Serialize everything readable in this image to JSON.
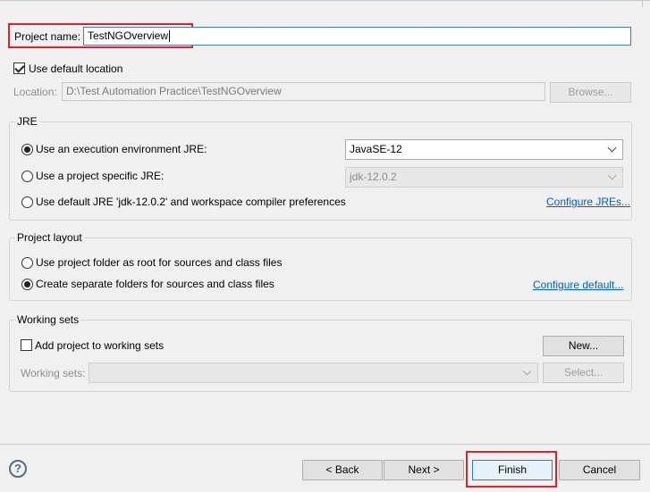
{
  "project": {
    "name_label": "Project name:",
    "name_value": "TestNGOverview"
  },
  "location": {
    "use_default_label": "Use default location",
    "use_default_checked": true,
    "label": "Location:",
    "value": "D:\\Test Automation Practice\\TestNGOverview",
    "browse_label": "Browse..."
  },
  "jre": {
    "group_title": "JRE",
    "options": [
      {
        "label": "Use an execution environment JRE:",
        "checked": true
      },
      {
        "label": "Use a project specific JRE:",
        "checked": false
      },
      {
        "label": "Use default JRE 'jdk-12.0.2' and workspace compiler preferences",
        "checked": false
      }
    ],
    "execution_env_value": "JavaSE-12",
    "project_jre_value": "jdk-12.0.2",
    "configure_link": "Configure JREs..."
  },
  "layout": {
    "group_title": "Project layout",
    "options": [
      {
        "label": "Use project folder as root for sources and class files",
        "checked": false
      },
      {
        "label": "Create separate folders for sources and class files",
        "checked": true
      }
    ],
    "configure_link": "Configure default..."
  },
  "working_sets": {
    "group_title": "Working sets",
    "add_label": "Add project to working sets",
    "add_checked": false,
    "new_button": "New...",
    "sets_label": "Working sets:",
    "sets_value": "",
    "select_button": "Select..."
  },
  "footer": {
    "help_glyph": "?",
    "back_button": "< Back",
    "next_button": "Next >",
    "finish_button": "Finish",
    "cancel_button": "Cancel"
  },
  "colors": {
    "highlight_box": "#e0202c",
    "link": "#0060c0",
    "default_button_border": "#2a7ad0"
  }
}
